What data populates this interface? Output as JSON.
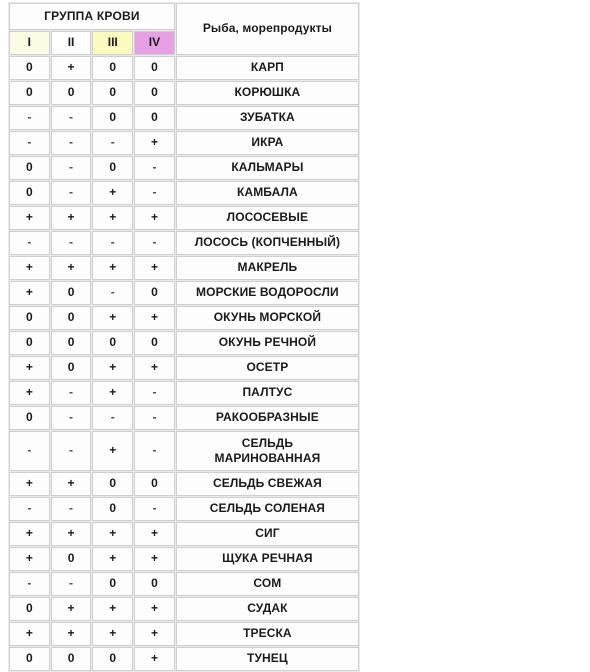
{
  "table": {
    "header": {
      "group_title": "ГРУППА КРОВИ",
      "product_title": "Рыба, морепродукты",
      "blood_groups": [
        {
          "label": "I",
          "color": "#fcfce4"
        },
        {
          "label": "II",
          "color": "#fefefe"
        },
        {
          "label": "III",
          "color": "#fbfbbd"
        },
        {
          "label": "IV",
          "color": "#e7a0e4"
        }
      ]
    },
    "rows": [
      {
        "name": "КАРП",
        "marks": [
          "0",
          "+",
          "0",
          "0"
        ]
      },
      {
        "name": "КОРЮШКА",
        "marks": [
          "0",
          "0",
          "0",
          "0"
        ]
      },
      {
        "name": "ЗУБАТКА",
        "marks": [
          "-",
          "-",
          "0",
          "0"
        ]
      },
      {
        "name": "ИКРА",
        "marks": [
          "-",
          "-",
          "-",
          "+"
        ]
      },
      {
        "name": "КАЛЬМАРЫ",
        "marks": [
          "0",
          "-",
          "0",
          "-"
        ]
      },
      {
        "name": "КАМБАЛА",
        "marks": [
          "0",
          "-",
          "+",
          "-"
        ]
      },
      {
        "name": "ЛОСОСЕВЫЕ",
        "marks": [
          "+",
          "+",
          "+",
          "+"
        ]
      },
      {
        "name": "ЛОСОСЬ (КОПЧЕННЫЙ)",
        "marks": [
          "-",
          "-",
          "-",
          "-"
        ]
      },
      {
        "name": "МАКРЕЛЬ",
        "marks": [
          "+",
          "+",
          "+",
          "+"
        ]
      },
      {
        "name": "МОРСКИЕ ВОДОРОСЛИ",
        "marks": [
          "+",
          "0",
          "-",
          "0"
        ]
      },
      {
        "name": "ОКУНЬ МОРСКОЙ",
        "marks": [
          "0",
          "0",
          "+",
          "+"
        ]
      },
      {
        "name": "ОКУНЬ РЕЧНОЙ",
        "marks": [
          "0",
          "0",
          "0",
          "0"
        ]
      },
      {
        "name": "ОСЕТР",
        "marks": [
          "+",
          "0",
          "+",
          "+"
        ]
      },
      {
        "name": "ПАЛТУС",
        "marks": [
          "+",
          "-",
          "+",
          "-"
        ]
      },
      {
        "name": "РАКООБРАЗНЫЕ",
        "marks": [
          "0",
          "-",
          "-",
          "-"
        ]
      },
      {
        "name": "СЕЛЬДЬ МАРИНОВАННАЯ",
        "marks": [
          "-",
          "-",
          "+",
          "-"
        ],
        "tall": true,
        "name_lines": [
          "СЕЛЬДЬ",
          "МАРИНОВАННАЯ"
        ]
      },
      {
        "name": "СЕЛЬДЬ СВЕЖАЯ",
        "marks": [
          "+",
          "+",
          "0",
          "0"
        ]
      },
      {
        "name": "СЕЛЬДЬ СОЛЕНАЯ",
        "marks": [
          "-",
          "-",
          "0",
          "-"
        ]
      },
      {
        "name": "СИГ",
        "marks": [
          "+",
          "+",
          "+",
          "+"
        ]
      },
      {
        "name": "ЩУКА РЕЧНАЯ",
        "marks": [
          "+",
          "0",
          "+",
          "+"
        ]
      },
      {
        "name": "СОМ",
        "marks": [
          "-",
          "-",
          "0",
          "0"
        ]
      },
      {
        "name": "СУДАК",
        "marks": [
          "0",
          "+",
          "+",
          "+"
        ]
      },
      {
        "name": "ТРЕСКА",
        "marks": [
          "+",
          "+",
          "+",
          "+"
        ]
      },
      {
        "name": "ТУНЕЦ",
        "marks": [
          "0",
          "0",
          "0",
          "+"
        ]
      }
    ]
  }
}
